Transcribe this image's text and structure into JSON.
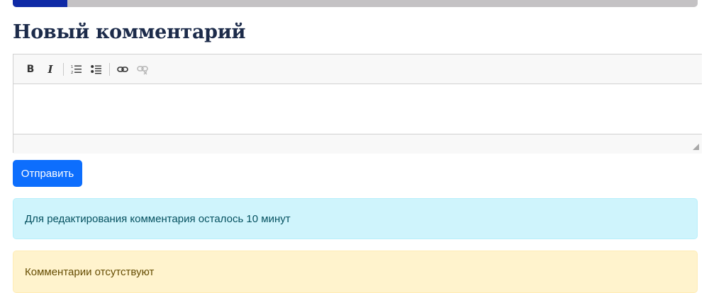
{
  "progress": {
    "fraction": 0.08
  },
  "form": {
    "title": "Новый комментарий",
    "toolbar": {
      "bold_label": "B",
      "italic_label": "I",
      "icons": [
        "numbered-list-icon",
        "bulleted-list-icon",
        "link-icon",
        "unlink-icon"
      ]
    },
    "editor_value": "",
    "submit_label": "Отправить"
  },
  "alerts": {
    "info": "Для редактирования комментария осталось 10 минут",
    "warning": "Комментарии отсутствуют"
  },
  "colors": {
    "primary": "#0d6efd",
    "title": "#1c2b4a",
    "progress_fill": "#0f2aa6",
    "info_bg": "#cff4fc",
    "warning_bg": "#fff3cd"
  }
}
